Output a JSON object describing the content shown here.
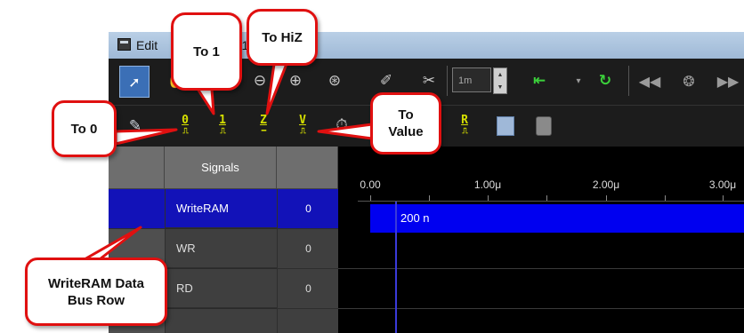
{
  "window": {
    "title": "Edit",
    "title_suffix": "rm1"
  },
  "toolbar": {
    "zoom_value": "1m",
    "tools": [
      "pointer-icon",
      "hand-icon",
      "pen-icon",
      "zoom-out-icon",
      "zoom-in-icon",
      "zoom-fit-icon"
    ],
    "wave_buttons": [
      {
        "glyph": "0",
        "name": "to-0"
      },
      {
        "glyph": "1",
        "name": "to-1"
      },
      {
        "glyph": "Z",
        "name": "to-hiz"
      },
      {
        "glyph": "V",
        "name": "to-value"
      },
      {
        "glyph": "R",
        "name": "r"
      }
    ]
  },
  "grid": {
    "header": {
      "signals": "Signals"
    },
    "rows": [
      {
        "name": "WriteRAM",
        "value": "0",
        "selected": true
      },
      {
        "name": "WR",
        "value": "0",
        "selected": false
      },
      {
        "name": "RD",
        "value": "0",
        "selected": false
      }
    ]
  },
  "waveform": {
    "ticks": [
      "0.00",
      "1.00μ",
      "2.00μ",
      "3.00μ"
    ],
    "bus_label": "200 n"
  },
  "callouts": {
    "to1": "To 1",
    "tohiz": "To HiZ",
    "to0": "To 0",
    "tovalue_line1": "To",
    "tovalue_line2": "Value",
    "writeram_line1": "WriteRAM Data",
    "writeram_line2": "Bus Row"
  },
  "colors": {
    "callout_border": "#e01010",
    "selected_row": "#1212b8",
    "bus": "#0000f0",
    "wave_button": "#d6e000"
  }
}
